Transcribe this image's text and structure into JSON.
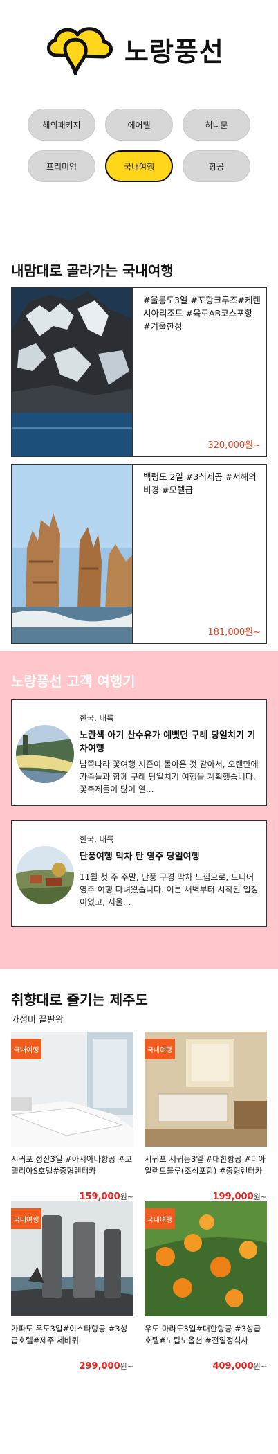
{
  "brand": {
    "name": "노랑풍선",
    "colors": {
      "yellow": "#ffd61a",
      "orange": "#f05b1e",
      "pink": "#ffc6cc",
      "price": "#e8431f"
    }
  },
  "categories": [
    {
      "label": "해외패키지",
      "active": false
    },
    {
      "label": "에어텔",
      "active": false
    },
    {
      "label": "허니문",
      "active": false
    },
    {
      "label": "프리미엄",
      "active": false
    },
    {
      "label": "국내여행",
      "active": true
    },
    {
      "label": "항공",
      "active": false
    }
  ],
  "domestic": {
    "title": "내맘대로 골라가는 국내여행",
    "cards": [
      {
        "text": "#울릉도3일 #포항크루즈#케렌시아리조트 #육로AB코스포항 #겨울한정",
        "price": "320,000원~"
      },
      {
        "text": "백령도 2일 #3식제공 #서해의비경 #모텔급",
        "price": "181,000원~"
      }
    ]
  },
  "reviews": {
    "title": "노랑풍선 고객 여행기",
    "items": [
      {
        "location": "한국, 내륙",
        "title": "노란색 아기 산수유가 예뻣던 구례 당일치기 기차여행",
        "body": "남쪽나라 꽃여행 시즌이 돌아온 것 같아서, 오랜만에 가족들과 함께 구례 당일치기 여행을 계획했습니다. 꽃축제들이 많이 열..."
      },
      {
        "location": "한국, 내륙",
        "title": "단풍여행 막차 탄 영주 당일여행",
        "body": "11월 첫 주 주말, 단풍 구경 막차 느낌으로, 드디어 영주 여행 다녀왔습니다. 이른 새벽부터 시작된 일정이었고, 서울..."
      }
    ]
  },
  "jeju": {
    "title": "취향대로 즐기는 제주도",
    "subtitle": "가성비 끝판왕",
    "badge": "국내여행",
    "items": [
      {
        "desc": "서귀포 성산3일 #아시아나항공 #코델리아S호텔#중형렌터카",
        "price": "159,000",
        "unit": "원~"
      },
      {
        "desc": "서귀포 서귀동3일 #대한항공 #디아일랜드블루(조식포함) #중형렌터카",
        "price": "199,000",
        "unit": "원~"
      },
      {
        "desc": "가파도 우도3일#이스타항공 #3성급호텔#제주 세바퀴",
        "price": "299,000",
        "unit": "원~"
      },
      {
        "desc": "우도 마라도3일#대한항공 #3성급호텔#노팁노옵션 #전일정식사",
        "price": "409,000",
        "unit": "원~"
      }
    ]
  }
}
